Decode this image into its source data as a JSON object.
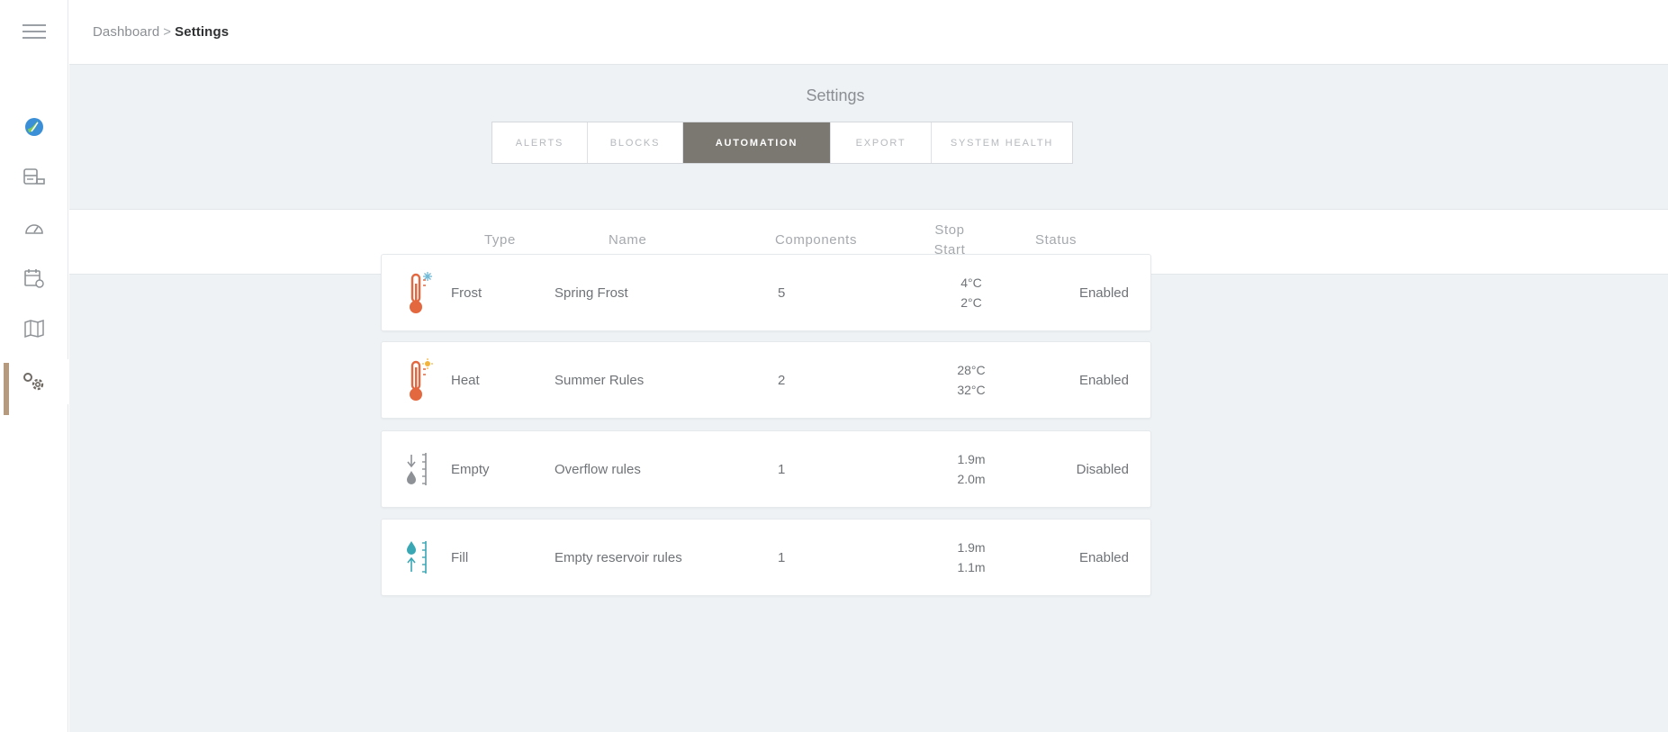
{
  "breadcrumb": {
    "parent": "Dashboard",
    "separator": ">",
    "current": "Settings"
  },
  "page": {
    "title": "Settings"
  },
  "tabs": [
    {
      "label": "ALERTS",
      "active": false
    },
    {
      "label": "BLOCKS",
      "active": false
    },
    {
      "label": "AUTOMATION",
      "active": true
    },
    {
      "label": "EXPORT",
      "active": false
    },
    {
      "label": "SYSTEM HEALTH",
      "active": false
    }
  ],
  "columns": {
    "type": "Type",
    "name": "Name",
    "components": "Components",
    "stop": "Stop",
    "start": "Start",
    "status": "Status"
  },
  "sidebar": {
    "items": [
      {
        "icon": "menu-icon"
      },
      {
        "icon": "logo-leaf-icon"
      },
      {
        "icon": "machine-icon"
      },
      {
        "icon": "gauge-icon"
      },
      {
        "icon": "calendar-settings-icon"
      },
      {
        "icon": "map-icon"
      },
      {
        "icon": "gears-icon",
        "active": true
      }
    ]
  },
  "rules": [
    {
      "icon": "frost-thermometer-icon",
      "type": "Frost",
      "name": "Spring Frost",
      "components": "5",
      "stop": "4°C",
      "start": "2°C",
      "status": "Enabled"
    },
    {
      "icon": "heat-thermometer-icon",
      "type": "Heat",
      "name": "Summer Rules",
      "components": "2",
      "stop": "28°C",
      "start": "32°C",
      "status": "Enabled"
    },
    {
      "icon": "empty-level-icon",
      "type": "Empty",
      "name": "Overflow rules",
      "components": "1",
      "stop": "1.9m",
      "start": "2.0m",
      "status": "Disabled"
    },
    {
      "icon": "fill-level-icon",
      "type": "Fill",
      "name": "Empty reservoir rules",
      "components": "1",
      "stop": "1.9m",
      "start": "1.1m",
      "status": "Enabled"
    }
  ],
  "colors": {
    "accent": "#b59a80",
    "active_tab": "#7b7771",
    "thermo_red": "#e4683f",
    "water_teal": "#3aa7b5",
    "neutral_gray": "#8e9296",
    "background": "#eef2f5"
  }
}
